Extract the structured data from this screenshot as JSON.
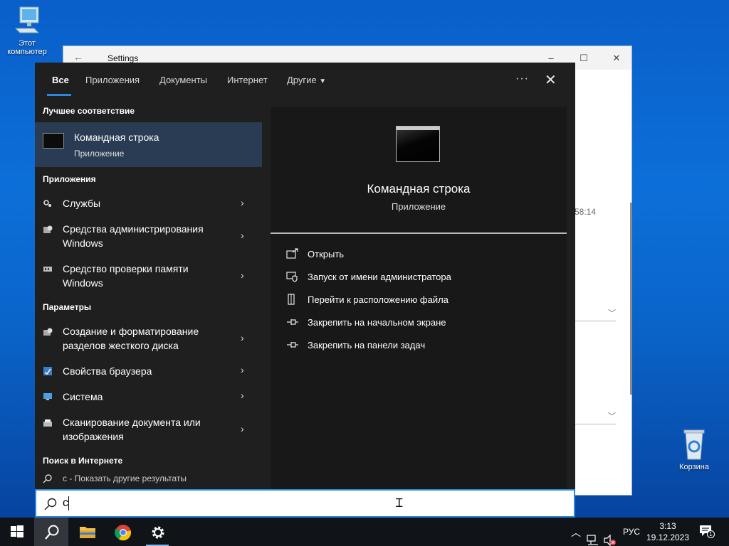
{
  "desktop": {
    "pc_label": "Этот компьютер",
    "recycle_label": "Корзина"
  },
  "settings": {
    "title": "Settings",
    "time_fragment": "58:14",
    "minimize": "–",
    "maximize": "☐",
    "close": "✕"
  },
  "tabs": [
    {
      "label": "Все",
      "active": true
    },
    {
      "label": "Приложения",
      "active": false
    },
    {
      "label": "Документы",
      "active": false
    },
    {
      "label": "Интернет",
      "active": false
    },
    {
      "label": "Другие",
      "active": false
    }
  ],
  "more_label": "···",
  "close_label": "✕",
  "sections": {
    "best": "Лучшее соответствие",
    "apps": "Приложения",
    "params": "Параметры",
    "web": "Поиск в Интернете"
  },
  "best_match": {
    "name": "Командная строка",
    "type": "Приложение"
  },
  "apps": [
    {
      "label": "Службы"
    },
    {
      "label": "Средства администрирования Windows"
    },
    {
      "label": "Средство проверки памяти Windows"
    }
  ],
  "params": [
    {
      "label": "Создание и форматирование разделов жесткого диска"
    },
    {
      "label": "Свойства браузера"
    },
    {
      "label": "Система"
    },
    {
      "label": "Сканирование документа или изображения"
    }
  ],
  "web_result": "c - Показать другие результаты",
  "preview": {
    "title": "Командная строка",
    "subtitle": "Приложение",
    "actions": [
      {
        "icon": "open-icon",
        "label": "Открыть"
      },
      {
        "icon": "shield-icon",
        "label": "Запуск от имени администратора"
      },
      {
        "icon": "file-location-icon",
        "label": "Перейти к расположению файла"
      },
      {
        "icon": "pin-icon",
        "label": "Закрепить на начальном экране"
      },
      {
        "icon": "pin-icon",
        "label": "Закрепить на панели задач"
      }
    ]
  },
  "search": {
    "query": "c"
  },
  "taskbar": {
    "language": "РУС",
    "time": "3:13",
    "date": "19.12.2023",
    "notification_count": "1"
  },
  "colors": {
    "accent": "#2d86e0",
    "panel_bg": "#1f1f1f",
    "preview_bg": "#181818",
    "selected_bg": "#2a3c53",
    "taskbar_bg": "#101419"
  }
}
